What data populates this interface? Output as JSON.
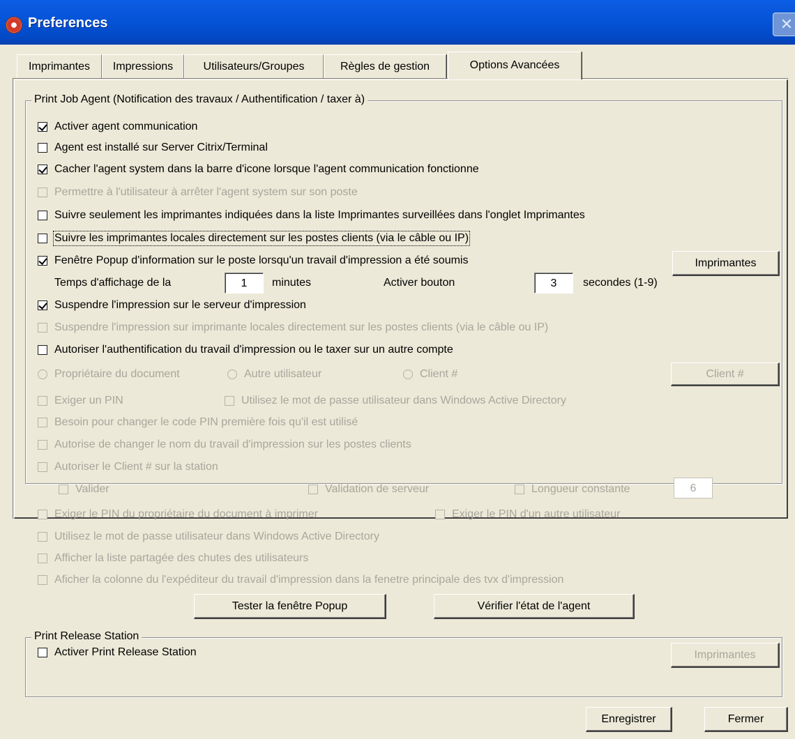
{
  "window": {
    "title": "Preferences",
    "close_label": "✕"
  },
  "tabs": [
    {
      "label": "Imprimantes"
    },
    {
      "label": "Impressions"
    },
    {
      "label": "Utilisateurs/Groupes"
    },
    {
      "label": "Règles de gestion"
    },
    {
      "label": "Options Avancées",
      "active": true
    }
  ],
  "print_job_agent": {
    "legend": "Print Job Agent (Notification des travaux / Authentification / taxer à)",
    "options": [
      {
        "label": "Activer agent communication",
        "checked": true,
        "enabled": true
      },
      {
        "label": "Agent est installé sur Server Citrix/Terminal",
        "checked": false,
        "enabled": true
      },
      {
        "label": "Cacher l'agent system dans la barre d'icone lorsque l'agent communication fonctionne",
        "checked": true,
        "enabled": true
      },
      {
        "label": "Permettre à l'utilisateur à arrêter l'agent system sur son poste",
        "checked": false,
        "enabled": false
      },
      {
        "label": "Suivre seulement les imprimantes indiquées dans la liste Imprimantes surveillées dans l'onglet Imprimantes",
        "checked": false,
        "enabled": true
      },
      {
        "label": "Suivre les imprimantes locales directement sur les postes clients (via le câble ou IP)",
        "checked": false,
        "enabled": true
      },
      {
        "label": "Fenêtre Popup d'information sur le poste lorsqu'un travail d'impression a été soumis",
        "checked": true,
        "enabled": true
      }
    ],
    "printers_button": "Imprimantes",
    "display_time_label": "Temps d'affichage de la",
    "display_time_value": "1",
    "minutes_label": "minutes",
    "activate_button_label": "Activer bouton",
    "activate_button_value": "3",
    "seconds_label": "secondes (1-9)",
    "options2": [
      {
        "label": "Suspendre l'impression sur le serveur d'impression",
        "checked": true,
        "enabled": true
      },
      {
        "label": "Suspendre l'impression sur imprimante locales directement sur les postes clients (via le câble ou IP)",
        "checked": false,
        "enabled": false
      },
      {
        "label": "Autoriser l'authentification du travail d'impression ou le taxer sur un autre compte",
        "checked": false,
        "enabled": true
      }
    ],
    "radios": [
      {
        "label": "Propriétaire du document"
      },
      {
        "label": "Autre utilisateur"
      },
      {
        "label": "Client #"
      }
    ],
    "client_button": "Client #",
    "require_pin": "Exiger un PIN",
    "use_ad_password": "Utilisez le mot de passe utilisateur dans Windows Active Directory",
    "change_pin_first": "Besoin pour changer le code PIN première fois qu'il est utilisé",
    "allow_rename": "Autorise de  changer le nom du travail d'impression sur les postes clients",
    "allow_client": "Autoriser le Client # sur la station",
    "validate": "Valider",
    "server_validation": "Validation de serveur",
    "constant_length": "Longueur constante",
    "constant_length_value": "6",
    "require_owner_pin": "Exiger le PIN du propriétaire du document à imprimer",
    "require_other_pin": "Exiger le  PIN  d'un autre utilisateur",
    "use_ad_password2": "Utilisez le mot de passe utilisateur dans Windows Active Directory",
    "show_shared_list": "Afficher la liste partagée  des chutes des utilisateurs",
    "show_sender_column": "Aficher la colonne du l'expéditeur du travail d'impression dans la fenetre principale des tvx d'impression",
    "test_popup_button": "Tester la fenêtre Popup",
    "check_agent_button": "Vérifier l'état de l'agent"
  },
  "print_release": {
    "legend": "Print Release Station",
    "activate_label": "Activer Print Release Station",
    "printers_button": "Imprimantes"
  },
  "footer": {
    "save_button": "Enregistrer",
    "close_button": "Fermer"
  }
}
